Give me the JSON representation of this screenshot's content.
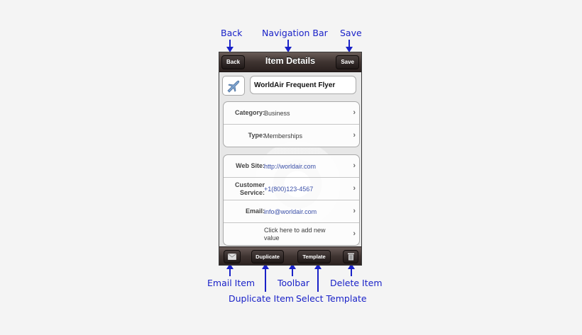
{
  "annotations": {
    "back": "Back",
    "navigation_bar": "Navigation Bar",
    "save": "Save",
    "email_item": "Email Item",
    "duplicate_item": "Duplicate Item",
    "toolbar": "Toolbar",
    "select_template": "Select Template",
    "delete_item": "Delete Item"
  },
  "navbar": {
    "title": "Item Details",
    "back_label": "Back",
    "save_label": "Save"
  },
  "item": {
    "icon": "airplane-icon",
    "name": "WorldAir Frequent Flyer"
  },
  "classification": [
    {
      "label": "Category:",
      "value": "Business"
    },
    {
      "label": "Type:",
      "value": "Memberships"
    }
  ],
  "fields": [
    {
      "label": "Web Site:",
      "value": "http://worldair.com"
    },
    {
      "label": "Customer Service:",
      "value": "+1(800)123-4567"
    },
    {
      "label": "Email:",
      "value": "info@worldair.com"
    },
    {
      "label": "",
      "value": "Click here to add new value"
    }
  ],
  "toolbar": {
    "email_icon": "envelope-icon",
    "duplicate_label": "Duplicate",
    "template_label": "Template",
    "delete_icon": "trash-icon"
  },
  "colors": {
    "callout": "#1a22c8",
    "bar": "#3f3431",
    "link": "#3a4fa8"
  }
}
